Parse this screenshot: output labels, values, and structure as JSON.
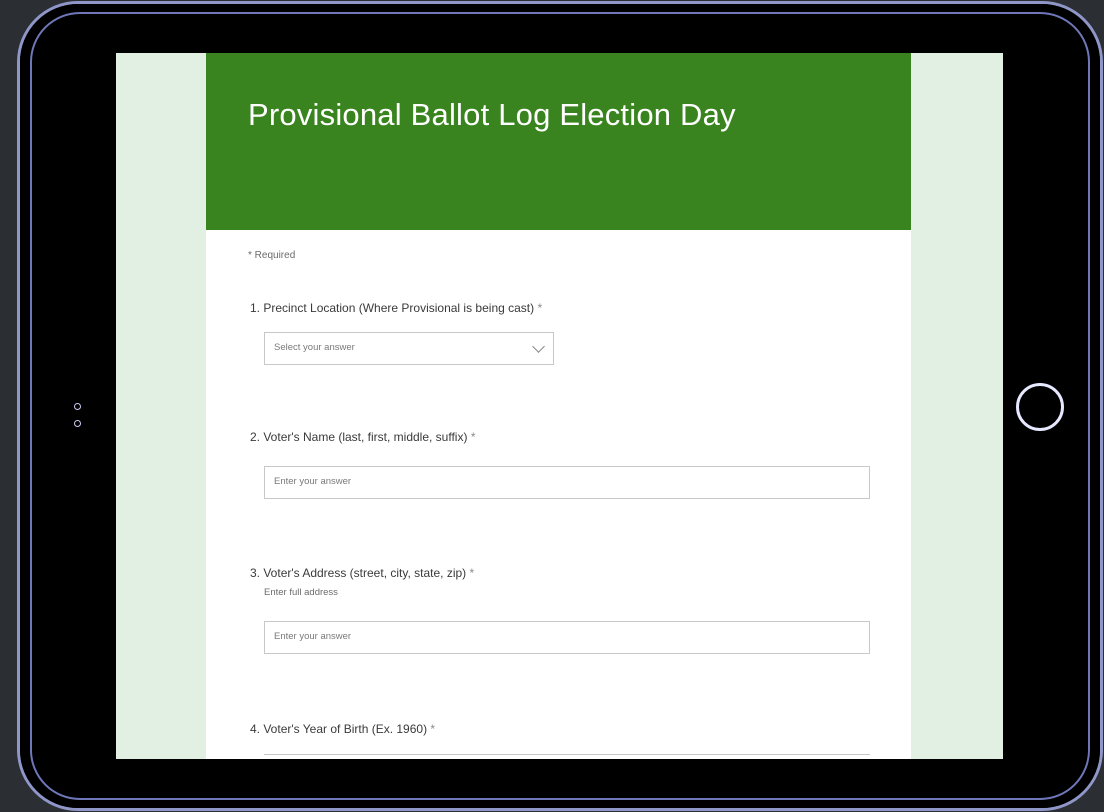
{
  "form": {
    "title": "Provisional Ballot Log Election Day",
    "required_note": "* Required",
    "questions": [
      {
        "label": "1. Precinct Location (Where Provisional is being cast)",
        "required": "*",
        "placeholder": "Select your answer"
      },
      {
        "label": "2. Voter's Name (last, first, middle, suffix)",
        "required": "*",
        "placeholder": "Enter your answer"
      },
      {
        "label": "3. Voter's Address (street, city, state, zip)",
        "required": "*",
        "subtitle": "Enter full address",
        "placeholder": "Enter your answer"
      },
      {
        "label": "4. Voter's Year of Birth (Ex. 1960)",
        "required": "*"
      }
    ]
  },
  "icons": {
    "dropdown_icon": "chevron-down-icon",
    "home_button": "home-button-icon",
    "camera": "camera-icon"
  },
  "colors": {
    "header_green": "#3a841f",
    "page_background": "#e2efe3",
    "tablet_frame": "#000000"
  }
}
